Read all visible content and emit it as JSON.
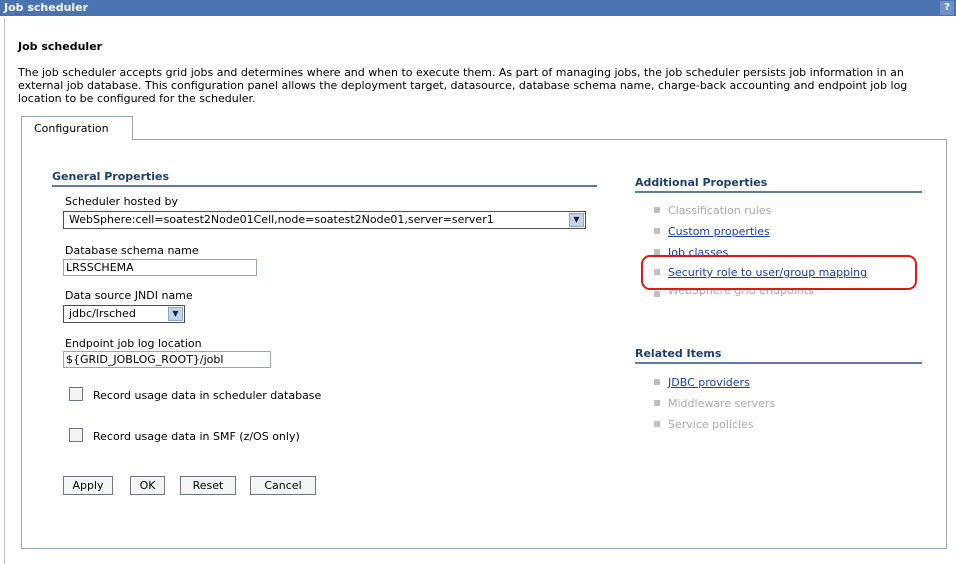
{
  "window": {
    "title": "Job scheduler",
    "help_glyph": "?"
  },
  "page": {
    "title": "Job scheduler",
    "description": "The job scheduler accepts grid jobs and determines where and when to execute them. As part of managing jobs, the job scheduler persists job information in an external job database. This configuration panel allows the deployment target, datasource, database schema name, charge-back accounting and endpoint job log location to be configured for the scheduler."
  },
  "tabs": [
    {
      "label": "Configuration",
      "selected": true
    }
  ],
  "general": {
    "heading": "General Properties",
    "scheduler_hosted_by": {
      "label": "Scheduler hosted by",
      "value": "WebSphere:cell=soatest2Node01Cell,node=soatest2Node01,server=server1"
    },
    "schema": {
      "label": "Database schema name",
      "value": "LRSSCHEMA"
    },
    "datasource": {
      "label": "Data source JNDI name",
      "value": "jdbc/lrsched"
    },
    "endpoint_log": {
      "label": "Endpoint job log location",
      "value": "${GRID_JOBLOG_ROOT}/jobl"
    },
    "record_db": {
      "label": "Record usage data in scheduler database",
      "checked": false
    },
    "record_smf": {
      "label": "Record usage data in SMF (z/OS only)",
      "checked": false
    },
    "buttons": {
      "apply": "Apply",
      "ok": "OK",
      "reset": "Reset",
      "cancel": "Cancel"
    }
  },
  "additional": {
    "heading": "Additional Properties",
    "items": [
      {
        "label": "Classification rules",
        "enabled": false
      },
      {
        "label": "Custom properties",
        "enabled": true
      },
      {
        "label": "Job classes",
        "enabled": true
      },
      {
        "label": "Security role to user/group mapping",
        "enabled": true,
        "highlighted": true
      },
      {
        "label": "WebSphere grid endpoints",
        "enabled": false
      }
    ]
  },
  "related": {
    "heading": "Related Items",
    "items": [
      {
        "label": "JDBC providers",
        "enabled": true
      },
      {
        "label": "Middleware servers",
        "enabled": false
      },
      {
        "label": "Service policies",
        "enabled": false
      }
    ]
  },
  "colors": {
    "title_bar": "#4a73b2",
    "section_heading": "#1f3f6b",
    "link": "#1a3ea6",
    "disabled": "#a9a9a9",
    "highlight_ring": "#e01818"
  }
}
